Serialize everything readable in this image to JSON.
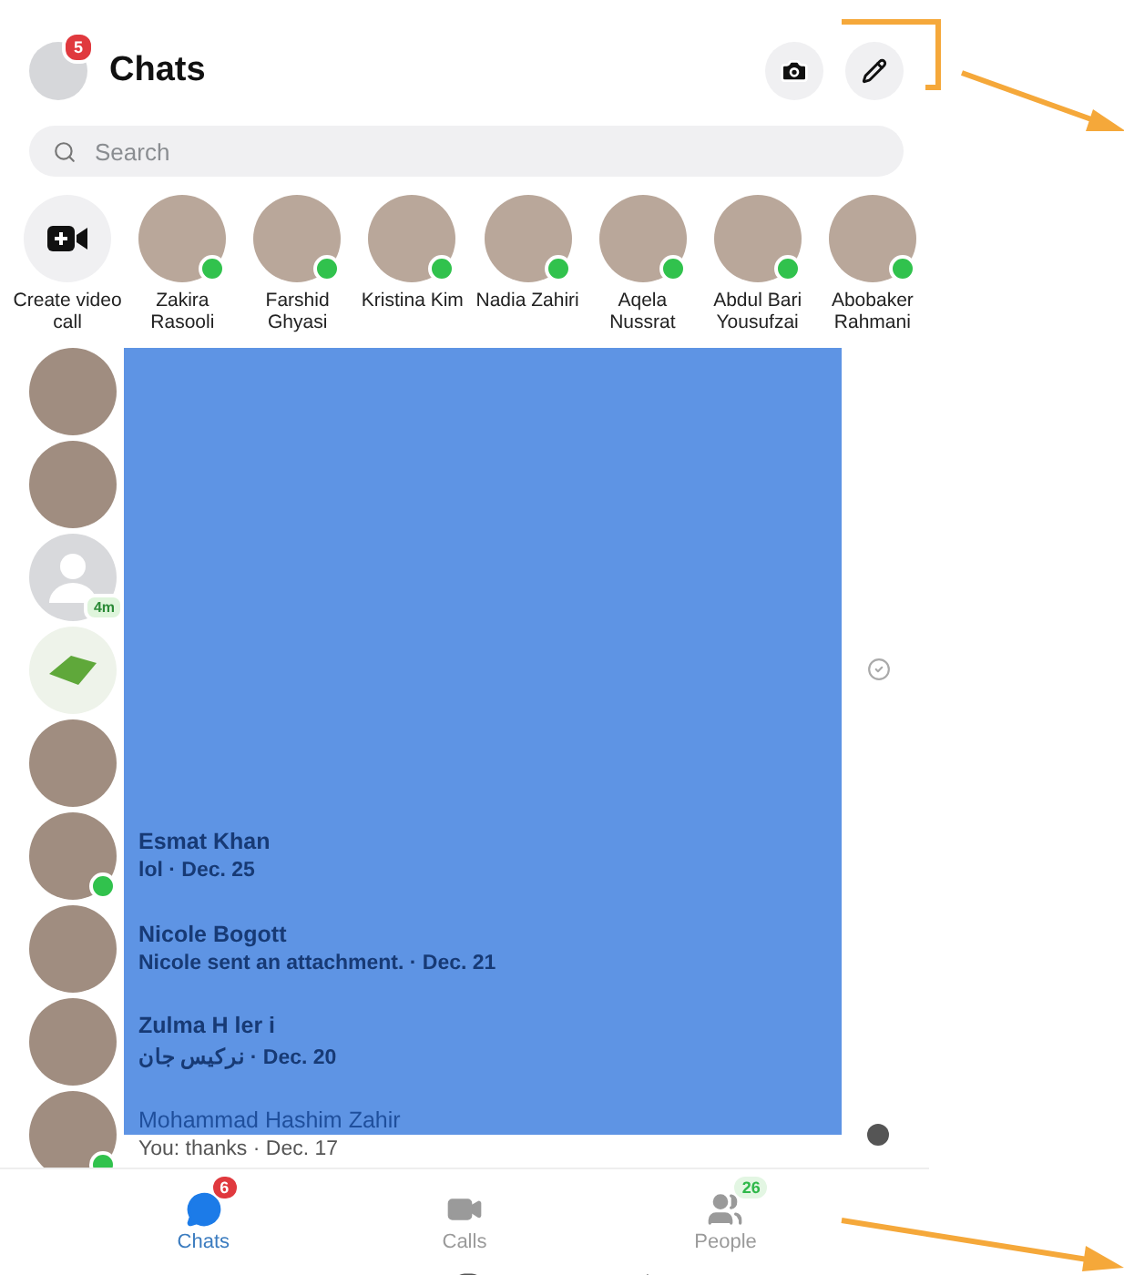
{
  "header": {
    "title": "Chats",
    "badge": "5"
  },
  "search": {
    "placeholder": "Search"
  },
  "stories": [
    {
      "kind": "create",
      "name": "Create video call"
    },
    {
      "kind": "contact",
      "name": "Zakira Rasooli",
      "online": true
    },
    {
      "kind": "contact",
      "name": "Farshid Ghyasi",
      "online": true
    },
    {
      "kind": "contact",
      "name": "Kristina Kim",
      "online": true
    },
    {
      "kind": "contact",
      "name": "Nadia Zahiri",
      "online": true
    },
    {
      "kind": "contact",
      "name": "Aqela Nussrat",
      "online": true
    },
    {
      "kind": "contact",
      "name": "Abdul Bari Yousufzai",
      "online": true
    },
    {
      "kind": "contact",
      "name": "Abobaker Rahmani",
      "online": true
    }
  ],
  "chats": [
    {
      "kind": "photo",
      "online": false
    },
    {
      "kind": "photo",
      "online": false
    },
    {
      "kind": "silhouette",
      "online": false,
      "badge": "4m"
    },
    {
      "kind": "logo",
      "online": false,
      "sent": true
    },
    {
      "kind": "photo",
      "online": false
    },
    {
      "kind": "photo",
      "online": true,
      "name": "Esmat Khan",
      "preview": "lol · Dec. 25",
      "unread": true
    },
    {
      "kind": "photo",
      "online": false,
      "name": "Nicole Bogott",
      "preview": "Nicole sent an attachment. · Dec. 21",
      "unread": true
    },
    {
      "kind": "photo",
      "online": false,
      "name": "Zulma H ler i",
      "preview": "نرکیس جان · Dec. 20",
      "unread": true
    },
    {
      "kind": "photo",
      "online": true,
      "name": "Mohammad Hashim Zahir",
      "preview": "You: thanks · Dec. 17",
      "unread": false,
      "seen": true
    }
  ],
  "nav": [
    {
      "kind": "chats",
      "label": "Chats",
      "selected": true,
      "badge": "6",
      "color": "#e0393e"
    },
    {
      "kind": "calls",
      "label": "Calls",
      "selected": false
    },
    {
      "kind": "people",
      "label": "People",
      "selected": false,
      "badge": "26",
      "color": "#2fb84a"
    }
  ]
}
